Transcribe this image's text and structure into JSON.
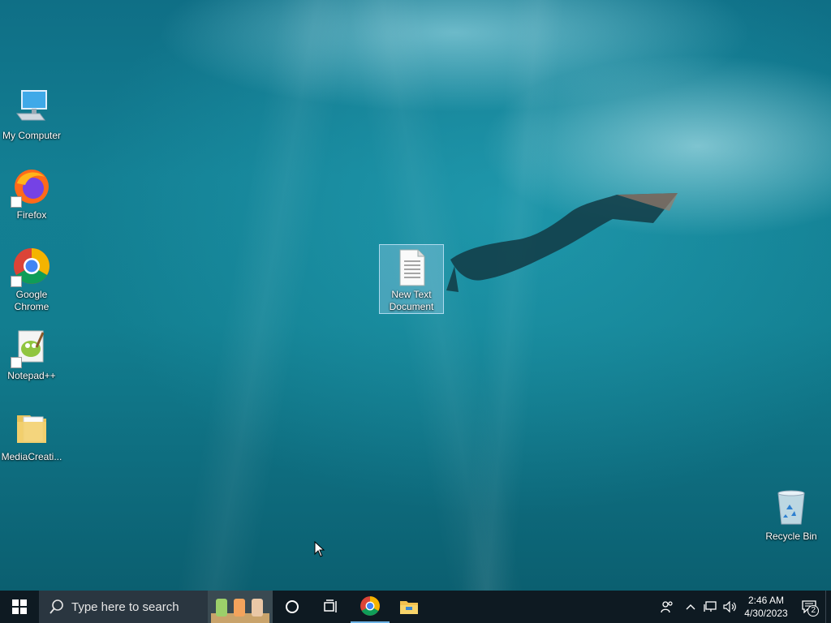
{
  "desktop": {
    "icons": [
      {
        "label": "My Computer"
      },
      {
        "label": "Firefox"
      },
      {
        "label": "Google Chrome"
      },
      {
        "label": "Notepad++"
      },
      {
        "label": "MediaCreati..."
      },
      {
        "label": "New Text Document",
        "selected": true
      },
      {
        "label": "Recycle Bin"
      }
    ]
  },
  "taskbar": {
    "search_placeholder": "Type here to search",
    "pinned": [
      "cortana-icon",
      "task-view-icon",
      "chrome-icon",
      "file-explorer-icon"
    ],
    "tray": {
      "time": "2:46 AM",
      "date": "4/30/2023",
      "notification_count": "2"
    }
  },
  "colors": {
    "taskbar_bg": "#0e1a22",
    "search_bg": "#2a3640",
    "water": "#137f93"
  }
}
